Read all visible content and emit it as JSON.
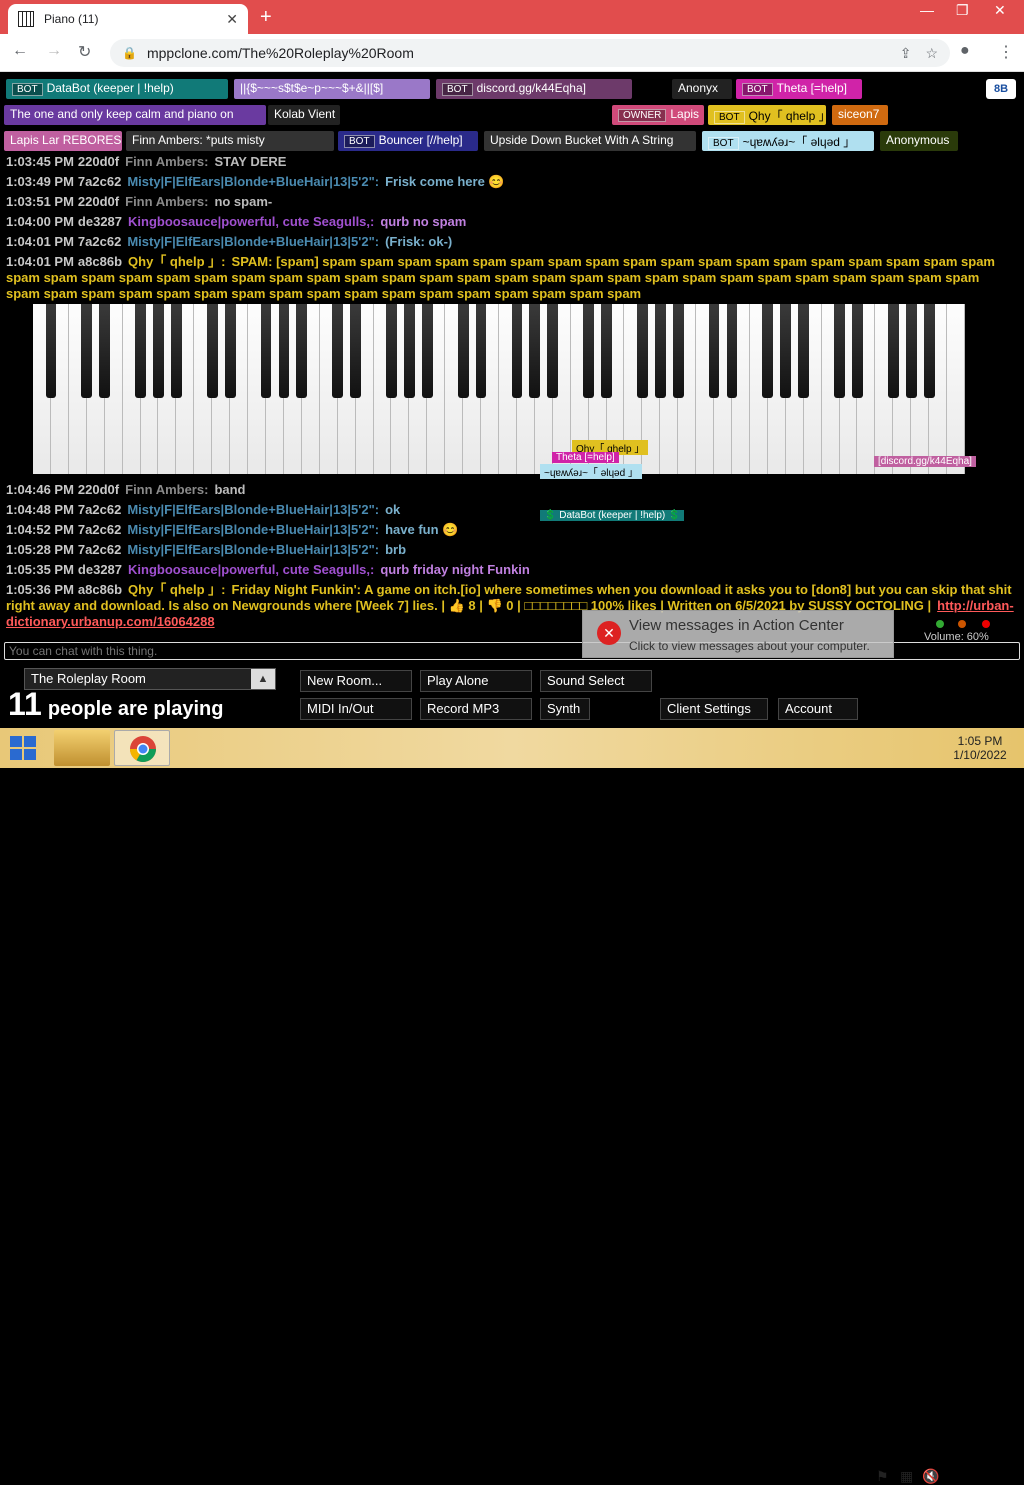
{
  "browser": {
    "tab_title": "Piano (11)",
    "url": "mppclone.com/The%20Roleplay%20Room"
  },
  "userbar": [
    {
      "tag": "BOT",
      "name": "DataBot (keeper | !help)",
      "color": "#117a78"
    },
    {
      "tag": "",
      "name": "||{$~~~s$t$e~p~~~$+&||[$]",
      "color": "#9a78c8"
    },
    {
      "tag": "BOT",
      "name": "discord.gg/k44Eqha]",
      "color": "#6d3a6a"
    },
    {
      "tag": "",
      "name": "Anonyx",
      "color": "#222222"
    },
    {
      "tag": "BOT",
      "name": "Theta [=help]",
      "color": "#d023a8"
    },
    {
      "tag": "",
      "name": "The one and only keep calm and piano on",
      "color": "#6a3aa0"
    },
    {
      "tag": "",
      "name": "Kolab Vient",
      "color": "#222222"
    },
    {
      "tag": "OWNER",
      "name": "Lapis",
      "color": "#d04a7a"
    },
    {
      "tag": "BOT",
      "name": "Qhy「 qhelp 」",
      "color": "#e0c020"
    },
    {
      "tag": "",
      "name": "siceon7",
      "color": "#d06a10"
    },
    {
      "tag": "",
      "name": "Lapis Lar REBORES",
      "color": "#c060a0"
    },
    {
      "tag": "",
      "name": "Finn Ambers: *puts misty",
      "color": "#333333"
    },
    {
      "tag": "BOT",
      "name": "Bouncer [//help]",
      "color": "#2a2a8a"
    },
    {
      "tag": "",
      "name": "Upside Down Bucket With A String",
      "color": "#333333"
    },
    {
      "tag": "BOT",
      "name": "~ɥɐʍʎǝɹ~「 ǝlɥǝd 」",
      "color": "#b0e0f0"
    },
    {
      "tag": "",
      "name": "Anonymous",
      "color": "#2a3a0a"
    }
  ],
  "corner_button": "8B",
  "chat": [
    {
      "time": "1:03:45 PM",
      "id": "220d0f",
      "nick": "Finn Ambers:",
      "nick_color": "#8a8a8a",
      "text": "STAY DERE",
      "text_color": "#bbbbbb"
    },
    {
      "time": "1:03:49 PM",
      "id": "7a2c62",
      "nick": "Misty|F|ElfEars|Blonde+BlueHair|13|5'2\":",
      "nick_color": "#4a8ab0",
      "text": "Frisk come here 😊",
      "text_color": "#7ab0cc"
    },
    {
      "time": "1:03:51 PM",
      "id": "220d0f",
      "nick": "Finn Ambers:",
      "nick_color": "#8a8a8a",
      "text": "no spam-",
      "text_color": "#bbbbbb"
    },
    {
      "time": "1:04:00 PM",
      "id": "de3287",
      "nick": "Kingboosauce|powerful, cute Seagulls,:",
      "nick_color": "#a050d0",
      "text": "qurb no spam",
      "text_color": "#c080e0"
    },
    {
      "time": "1:04:01 PM",
      "id": "7a2c62",
      "nick": "Misty|F|ElfEars|Blonde+BlueHair|13|5'2\":",
      "nick_color": "#4a8ab0",
      "text": "(Frisk: ok-)",
      "text_color": "#7ab0cc"
    },
    {
      "time": "1:04:01 PM",
      "id": "a8c86b",
      "nick": "Qhy「 qhelp 」:",
      "nick_color": "#e0c020",
      "text": "SPAM: [spam] spam spam spam spam spam spam spam spam spam spam spam spam spam spam spam spam spam spam spam spam spam spam spam spam spam spam spam spam spam spam spam spam spam spam spam spam spam spam spam spam spam spam spam spam spam spam spam spam spam spam spam spam spam spam spam spam spam spam spam spam spam",
      "text_color": "#e0c020"
    },
    {
      "time": "1:04:46 PM",
      "id": "220d0f",
      "nick": "Finn Ambers:",
      "nick_color": "#8a8a8a",
      "text": "band",
      "text_color": "#bbbbbb"
    },
    {
      "time": "1:04:48 PM",
      "id": "7a2c62",
      "nick": "Misty|F|ElfEars|Blonde+BlueHair|13|5'2\":",
      "nick_color": "#4a8ab0",
      "text": "ok",
      "text_color": "#7ab0cc"
    },
    {
      "time": "1:04:52 PM",
      "id": "7a2c62",
      "nick": "Misty|F|ElfEars|Blonde+BlueHair|13|5'2\":",
      "nick_color": "#4a8ab0",
      "text": "have fun 😊",
      "text_color": "#7ab0cc"
    },
    {
      "time": "1:05:28 PM",
      "id": "7a2c62",
      "nick": "Misty|F|ElfEars|Blonde+BlueHair|13|5'2\":",
      "nick_color": "#4a8ab0",
      "text": "brb",
      "text_color": "#7ab0cc"
    },
    {
      "time": "1:05:35 PM",
      "id": "de3287",
      "nick": "Kingboosauce|powerful, cute Seagulls,:",
      "nick_color": "#a050d0",
      "text": "qurb friday night Funkin",
      "text_color": "#c080e0"
    },
    {
      "time": "1:05:36 PM",
      "id": "a8c86b",
      "nick": "Qhy「 qhelp 」:",
      "nick_color": "#e0c020",
      "text": "Friday Night Funkin': A game on itch.[io] where sometimes when you download it asks you to [don8] but you can skip that shit right away and download. Is also on Newgrounds where [Week 7] lies. | 👍 8 | 👎 0 | □□□□□□□□ 100% likes | Written on 6/5/2021 by SUSSY OCTOLING |",
      "text_color": "#e0c020",
      "link": "http://urban-dictionary.urbanup.com/16064288"
    }
  ],
  "cursor_labels": [
    {
      "text": "Qhy「 qhelp 」",
      "bg": "#e0c020",
      "color": "#000"
    },
    {
      "text": "Theta [=help]",
      "bg": "#d023a8",
      "color": "#fff"
    },
    {
      "text": "~ɥɐʍʎǝɹ~「 ǝlɥǝd 」",
      "bg": "#b0e0f0",
      "color": "#000"
    },
    {
      "text": "[discord.gg/k44Eqha]",
      "bg": "#c060a0",
      "color": "#fff"
    },
    {
      "text": "💲 DataBot (keeper | !help) 💲",
      "bg": "#117a78",
      "color": "#fff"
    }
  ],
  "chat_input_placeholder": "You can chat with this thing.",
  "room": {
    "name": "The Roleplay Room",
    "count": "11",
    "count_text": "people are playing"
  },
  "buttons": {
    "new_room": "New Room...",
    "play_alone": "Play Alone",
    "sound_select": "Sound Select",
    "midi": "MIDI In/Out",
    "record": "Record MP3",
    "synth": "Synth",
    "client_settings": "Client Settings",
    "account": "Account"
  },
  "notification": {
    "title": "View messages in Action Center",
    "body": "Click to view messages about your computer."
  },
  "volume": "Volume: 60%",
  "clock": {
    "time": "1:05 PM",
    "date": "1/10/2022"
  }
}
